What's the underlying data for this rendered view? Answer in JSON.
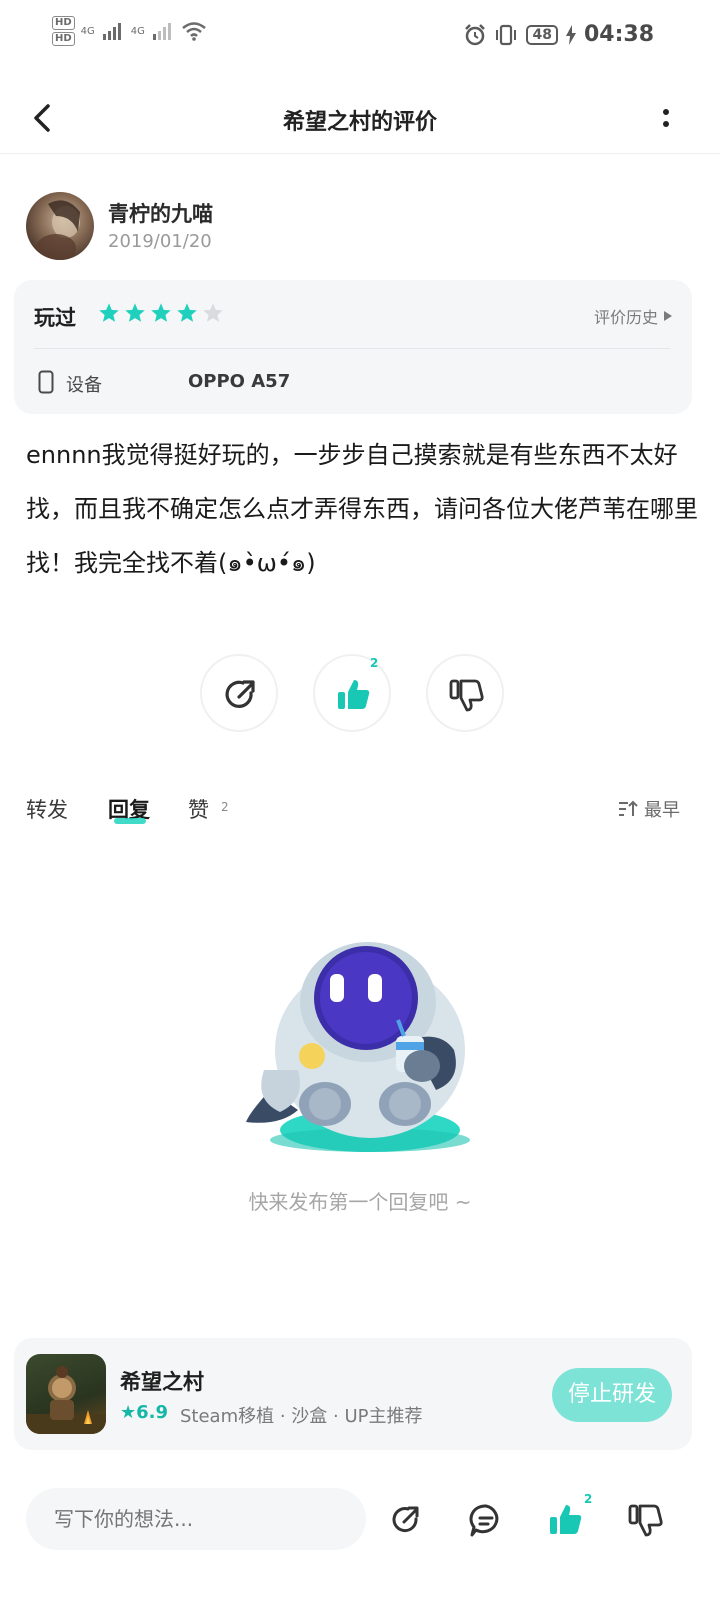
{
  "status_bar": {
    "hd1": "HD",
    "hd2": "HD",
    "net1": "4G",
    "net2": "4G",
    "battery": "48",
    "time": "04:38"
  },
  "nav": {
    "title": "希望之村的评价"
  },
  "author": {
    "name": "青柠的九喵",
    "date": "2019/01/20"
  },
  "rating": {
    "played_label": "玩过",
    "stars": 4,
    "max_stars": 5,
    "history_label": "评价历史",
    "device_label": "设备",
    "device_value": "OPPO A57"
  },
  "review": {
    "text": "ennnn我觉得挺好玩的，一步步自己摸索就是有些东西不太好找，而且我不确定怎么点才弄得东西，请问各位大佬芦苇在哪里找！我完全找不着(๑•̀ω•́๑)"
  },
  "actions": {
    "like_count": "2"
  },
  "tabs": {
    "forward": "转发",
    "reply": "回复",
    "likes": "赞",
    "likes_count": "2",
    "sort": "最早"
  },
  "empty": {
    "text": "快来发布第一个回复吧 ~"
  },
  "game": {
    "name": "希望之村",
    "score": "6.9",
    "tags": "Steam移植 · 沙盒 · UP主推荐",
    "button": "停止研发"
  },
  "bottom": {
    "placeholder": "写下你的想法...",
    "like_count": "2"
  },
  "colors": {
    "accent": "#19c7b5",
    "star": "#1fd1bd",
    "star_empty": "#d9dcde",
    "card_bg": "#f4f6f7"
  }
}
